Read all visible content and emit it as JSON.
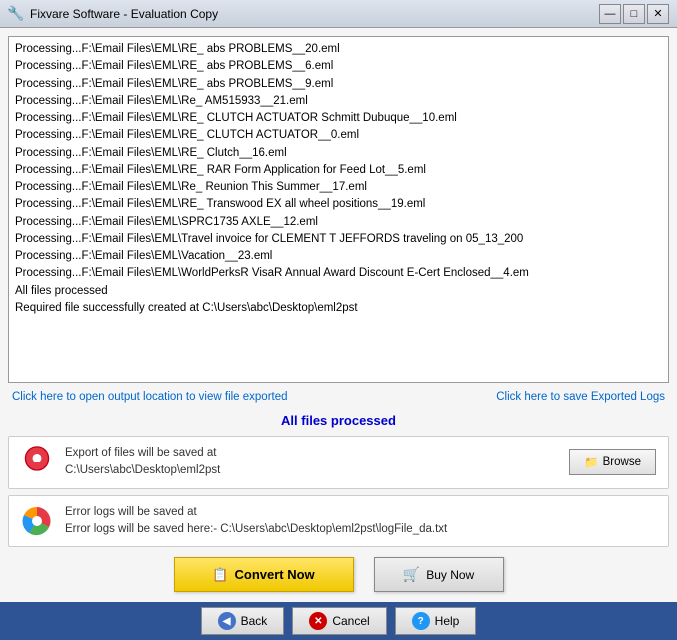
{
  "window": {
    "title": "Fixvare Software - Evaluation Copy",
    "icon": "🔧"
  },
  "titlebar": {
    "minimize_label": "—",
    "maximize_label": "□",
    "close_label": "✕"
  },
  "log": {
    "lines": [
      "Processing...F:\\Email Files\\EML\\RE_ abs PROBLEMS__20.eml",
      "Processing...F:\\Email Files\\EML\\RE_ abs PROBLEMS__6.eml",
      "Processing...F:\\Email Files\\EML\\RE_ abs PROBLEMS__9.eml",
      "Processing...F:\\Email Files\\EML\\Re_ AM515933__21.eml",
      "Processing...F:\\Email Files\\EML\\RE_ CLUTCH ACTUATOR Schmitt Dubuque__10.eml",
      "Processing...F:\\Email Files\\EML\\RE_ CLUTCH ACTUATOR__0.eml",
      "Processing...F:\\Email Files\\EML\\RE_ Clutch__16.eml",
      "Processing...F:\\Email Files\\EML\\RE_ RAR Form Application for Feed Lot__5.eml",
      "Processing...F:\\Email Files\\EML\\Re_ Reunion This Summer__17.eml",
      "Processing...F:\\Email Files\\EML\\RE_ Transwood EX all wheel positions__19.eml",
      "Processing...F:\\Email Files\\EML\\SPRC1735 AXLE__12.eml",
      "Processing...F:\\Email Files\\EML\\Travel invoice for CLEMENT T JEFFORDS traveling on 05_13_200",
      "Processing...F:\\Email Files\\EML\\Vacation__23.eml",
      "Processing...F:\\Email Files\\EML\\WorldPerksR VisaR Annual Award Discount E-Cert Enclosed__4.em",
      "All files processed",
      "",
      "Required file successfully created at C:\\Users\\abc\\Desktop\\eml2pst"
    ],
    "all_files_text": "All files processed",
    "required_file_text": "Required file successfully created at C:\\Users\\abc\\Desktop\\eml2pst"
  },
  "links": {
    "open_output": "Click here to open output location to view file exported",
    "save_logs": "Click here to save Exported Logs"
  },
  "status": {
    "text": "All files processed"
  },
  "export_panel": {
    "line1": "Export of files will be saved at",
    "line2": "C:\\Users\\abc\\Desktop\\eml2pst",
    "browse_label": "Browse"
  },
  "error_panel": {
    "line1": "Error logs will be saved at",
    "line2": "Error logs will be saved here:- C:\\Users\\abc\\Desktop\\eml2pst\\logFile_da.txt"
  },
  "buttons": {
    "convert_label": "Convert Now",
    "buy_label": "Buy Now",
    "back_label": "Back",
    "cancel_label": "Cancel",
    "help_label": "Help"
  }
}
